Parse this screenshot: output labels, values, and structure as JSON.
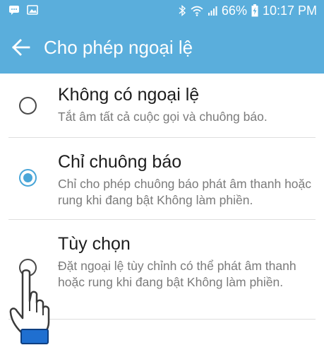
{
  "status_bar": {
    "battery": "66%",
    "time": "10:17 PM",
    "icons": [
      "message-icon",
      "image-icon",
      "bluetooth-icon",
      "wifi-icon",
      "signal-icon",
      "battery-charging-icon"
    ]
  },
  "header": {
    "title": "Cho phép ngoại lệ",
    "back_icon": "arrow-left-icon"
  },
  "options": [
    {
      "title": "Không có ngoại lệ",
      "description": "Tắt âm tất cả cuộc gọi và chuông báo.",
      "selected": false
    },
    {
      "title": "Chỉ chuông báo",
      "description": "Chỉ cho phép chuông báo phát âm thanh hoặc rung khi đang bật Không làm phiền.",
      "selected": true
    },
    {
      "title": "Tùy chọn",
      "description": "Đặt ngoại lệ tùy chỉnh có thể phát âm thanh hoặc rung khi đang bật Không làm phiền.",
      "selected": false
    }
  ],
  "colors": {
    "accent": "#5aaedc",
    "radio_selected": "#4aa6d8"
  }
}
